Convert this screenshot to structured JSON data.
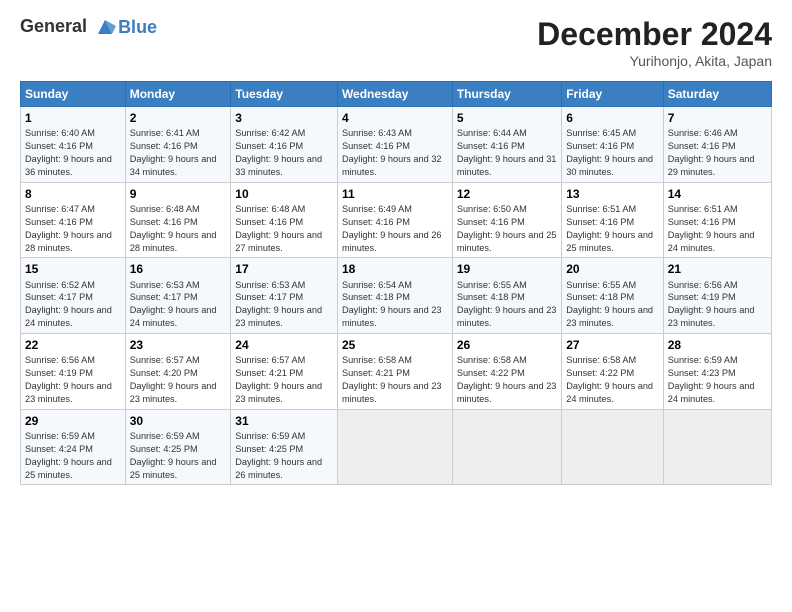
{
  "header": {
    "logo_line1": "General",
    "logo_line2": "Blue",
    "month": "December 2024",
    "location": "Yurihonjo, Akita, Japan"
  },
  "weekdays": [
    "Sunday",
    "Monday",
    "Tuesday",
    "Wednesday",
    "Thursday",
    "Friday",
    "Saturday"
  ],
  "weeks": [
    [
      {
        "day": "1",
        "sunrise": "6:40 AM",
        "sunset": "4:16 PM",
        "daylight": "9 hours and 36 minutes."
      },
      {
        "day": "2",
        "sunrise": "6:41 AM",
        "sunset": "4:16 PM",
        "daylight": "9 hours and 34 minutes."
      },
      {
        "day": "3",
        "sunrise": "6:42 AM",
        "sunset": "4:16 PM",
        "daylight": "9 hours and 33 minutes."
      },
      {
        "day": "4",
        "sunrise": "6:43 AM",
        "sunset": "4:16 PM",
        "daylight": "9 hours and 32 minutes."
      },
      {
        "day": "5",
        "sunrise": "6:44 AM",
        "sunset": "4:16 PM",
        "daylight": "9 hours and 31 minutes."
      },
      {
        "day": "6",
        "sunrise": "6:45 AM",
        "sunset": "4:16 PM",
        "daylight": "9 hours and 30 minutes."
      },
      {
        "day": "7",
        "sunrise": "6:46 AM",
        "sunset": "4:16 PM",
        "daylight": "9 hours and 29 minutes."
      }
    ],
    [
      {
        "day": "8",
        "sunrise": "6:47 AM",
        "sunset": "4:16 PM",
        "daylight": "9 hours and 28 minutes."
      },
      {
        "day": "9",
        "sunrise": "6:48 AM",
        "sunset": "4:16 PM",
        "daylight": "9 hours and 28 minutes."
      },
      {
        "day": "10",
        "sunrise": "6:48 AM",
        "sunset": "4:16 PM",
        "daylight": "9 hours and 27 minutes."
      },
      {
        "day": "11",
        "sunrise": "6:49 AM",
        "sunset": "4:16 PM",
        "daylight": "9 hours and 26 minutes."
      },
      {
        "day": "12",
        "sunrise": "6:50 AM",
        "sunset": "4:16 PM",
        "daylight": "9 hours and 25 minutes."
      },
      {
        "day": "13",
        "sunrise": "6:51 AM",
        "sunset": "4:16 PM",
        "daylight": "9 hours and 25 minutes."
      },
      {
        "day": "14",
        "sunrise": "6:51 AM",
        "sunset": "4:16 PM",
        "daylight": "9 hours and 24 minutes."
      }
    ],
    [
      {
        "day": "15",
        "sunrise": "6:52 AM",
        "sunset": "4:17 PM",
        "daylight": "9 hours and 24 minutes."
      },
      {
        "day": "16",
        "sunrise": "6:53 AM",
        "sunset": "4:17 PM",
        "daylight": "9 hours and 24 minutes."
      },
      {
        "day": "17",
        "sunrise": "6:53 AM",
        "sunset": "4:17 PM",
        "daylight": "9 hours and 23 minutes."
      },
      {
        "day": "18",
        "sunrise": "6:54 AM",
        "sunset": "4:18 PM",
        "daylight": "9 hours and 23 minutes."
      },
      {
        "day": "19",
        "sunrise": "6:55 AM",
        "sunset": "4:18 PM",
        "daylight": "9 hours and 23 minutes."
      },
      {
        "day": "20",
        "sunrise": "6:55 AM",
        "sunset": "4:18 PM",
        "daylight": "9 hours and 23 minutes."
      },
      {
        "day": "21",
        "sunrise": "6:56 AM",
        "sunset": "4:19 PM",
        "daylight": "9 hours and 23 minutes."
      }
    ],
    [
      {
        "day": "22",
        "sunrise": "6:56 AM",
        "sunset": "4:19 PM",
        "daylight": "9 hours and 23 minutes."
      },
      {
        "day": "23",
        "sunrise": "6:57 AM",
        "sunset": "4:20 PM",
        "daylight": "9 hours and 23 minutes."
      },
      {
        "day": "24",
        "sunrise": "6:57 AM",
        "sunset": "4:21 PM",
        "daylight": "9 hours and 23 minutes."
      },
      {
        "day": "25",
        "sunrise": "6:58 AM",
        "sunset": "4:21 PM",
        "daylight": "9 hours and 23 minutes."
      },
      {
        "day": "26",
        "sunrise": "6:58 AM",
        "sunset": "4:22 PM",
        "daylight": "9 hours and 23 minutes."
      },
      {
        "day": "27",
        "sunrise": "6:58 AM",
        "sunset": "4:22 PM",
        "daylight": "9 hours and 24 minutes."
      },
      {
        "day": "28",
        "sunrise": "6:59 AM",
        "sunset": "4:23 PM",
        "daylight": "9 hours and 24 minutes."
      }
    ],
    [
      {
        "day": "29",
        "sunrise": "6:59 AM",
        "sunset": "4:24 PM",
        "daylight": "9 hours and 25 minutes."
      },
      {
        "day": "30",
        "sunrise": "6:59 AM",
        "sunset": "4:25 PM",
        "daylight": "9 hours and 25 minutes."
      },
      {
        "day": "31",
        "sunrise": "6:59 AM",
        "sunset": "4:25 PM",
        "daylight": "9 hours and 26 minutes."
      },
      null,
      null,
      null,
      null
    ]
  ]
}
